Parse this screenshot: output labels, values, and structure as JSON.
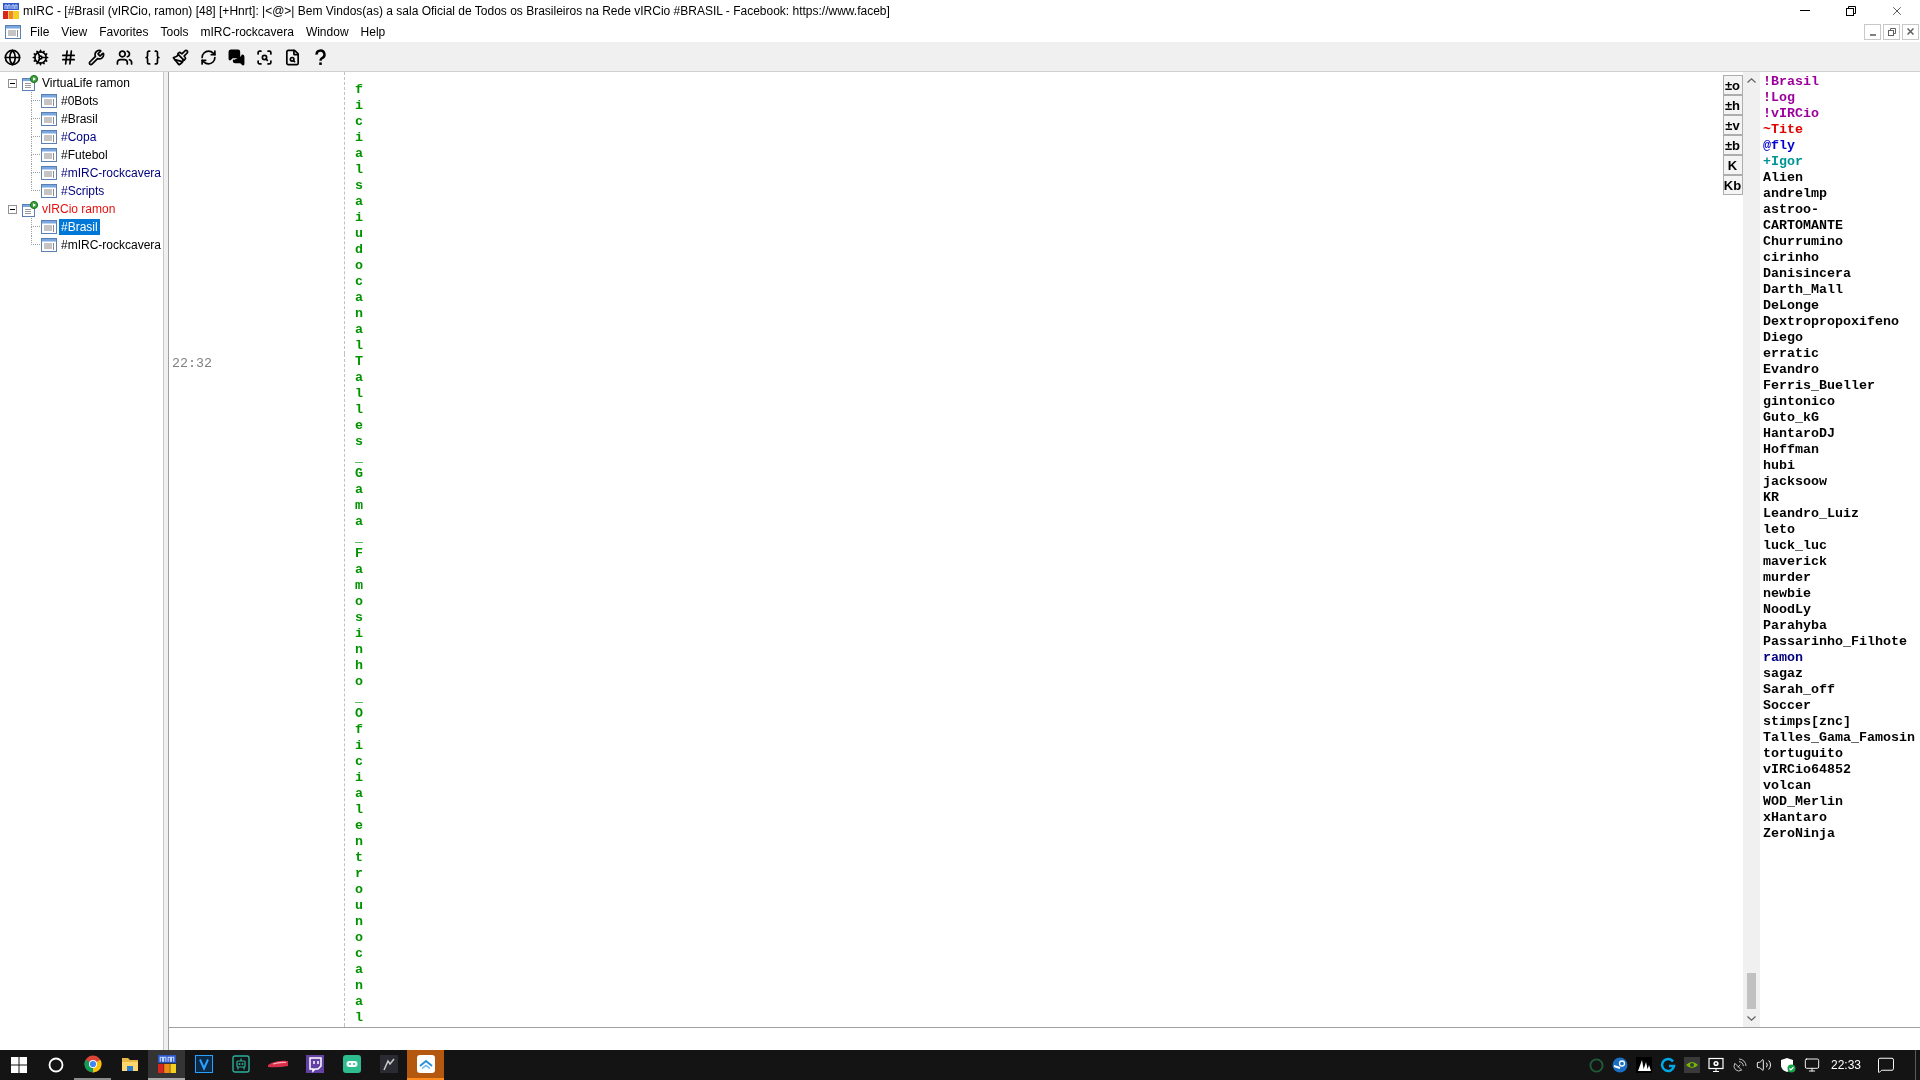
{
  "window": {
    "title": "mIRC - [#Brasil (vIRCio, ramon) [48] [+Hnrt]: |<@>| Bem Vindos(as) a sala Oficial de Todos os Brasileiros na Rede vIRCio #BRASIL - Facebook: https://www.faceb]"
  },
  "menu": [
    "File",
    "View",
    "Favorites",
    "Tools",
    "mIRC-rockcavera",
    "Window",
    "Help"
  ],
  "treebar": {
    "items": [
      {
        "label": "VirtuaLife ramon",
        "color": "#000000",
        "selected": false,
        "expanded": true,
        "children": [
          {
            "label": "#0Bots",
            "color": "#000000",
            "selected": false
          },
          {
            "label": "#Brasil",
            "color": "#000000",
            "selected": false
          },
          {
            "label": "#Copa",
            "color": "#00007f",
            "selected": false
          },
          {
            "label": "#Futebol",
            "color": "#000000",
            "selected": false
          },
          {
            "label": "#mIRC-rockcavera",
            "color": "#00007f",
            "selected": false
          },
          {
            "label": "#Scripts",
            "color": "#00007f",
            "selected": false
          }
        ]
      },
      {
        "label": "vIRCio ramon",
        "color": "#e81010",
        "selected": false,
        "expanded": true,
        "children": [
          {
            "label": "#Brasil",
            "selected": true
          },
          {
            "label": "#mIRC-rockcavera",
            "color": "#000000",
            "selected": false
          }
        ]
      }
    ]
  },
  "chat": {
    "lines": [
      {
        "text": "ficial saiu do canal"
      },
      {
        "time": "22:32",
        "text": "Talles_Gama_Famosinho_Oficial entrou no canal"
      }
    ]
  },
  "nick_buttons": [
    "±o",
    "±h",
    "±v",
    "±b",
    "K",
    "Kb"
  ],
  "nicklist": [
    {
      "nick": "!Brasil",
      "color": "#9c009c"
    },
    {
      "nick": "!Log",
      "color": "#9c009c"
    },
    {
      "nick": "!vIRCio",
      "color": "#9c009c"
    },
    {
      "nick": "~Tite",
      "color": "#e00000"
    },
    {
      "nick": "@fly",
      "color": "#0000d0"
    },
    {
      "nick": "+Igor",
      "color": "#009393"
    },
    {
      "nick": "Alien",
      "color": "#000000"
    },
    {
      "nick": "andrelmp",
      "color": "#000000"
    },
    {
      "nick": "astroo-",
      "color": "#000000"
    },
    {
      "nick": "CARTOMANTE",
      "color": "#000000"
    },
    {
      "nick": "Churrumino",
      "color": "#000000"
    },
    {
      "nick": "cirinho",
      "color": "#000000"
    },
    {
      "nick": "Danisincera",
      "color": "#000000"
    },
    {
      "nick": "Darth_Mall",
      "color": "#000000"
    },
    {
      "nick": "DeLonge",
      "color": "#000000"
    },
    {
      "nick": "Dextropropoxifeno",
      "color": "#000000"
    },
    {
      "nick": "Diego",
      "color": "#000000"
    },
    {
      "nick": "erratic",
      "color": "#000000"
    },
    {
      "nick": "Evandro",
      "color": "#000000"
    },
    {
      "nick": "Ferris_Bueller",
      "color": "#000000"
    },
    {
      "nick": "gintonico",
      "color": "#000000"
    },
    {
      "nick": "Guto_kG",
      "color": "#000000"
    },
    {
      "nick": "HantaroDJ",
      "color": "#000000"
    },
    {
      "nick": "Hoffman",
      "color": "#000000"
    },
    {
      "nick": "hubi",
      "color": "#000000"
    },
    {
      "nick": "jacksoow",
      "color": "#000000"
    },
    {
      "nick": "KR",
      "color": "#000000"
    },
    {
      "nick": "Leandro_Luiz",
      "color": "#000000"
    },
    {
      "nick": "leto",
      "color": "#000000"
    },
    {
      "nick": "luck_luc",
      "color": "#000000"
    },
    {
      "nick": "maverick",
      "color": "#000000"
    },
    {
      "nick": "murder",
      "color": "#000000"
    },
    {
      "nick": "newbie",
      "color": "#000000"
    },
    {
      "nick": "NoodLy",
      "color": "#000000"
    },
    {
      "nick": "Parahyba",
      "color": "#000000"
    },
    {
      "nick": "Passarinho_Filhote",
      "color": "#000000"
    },
    {
      "nick": "ramon",
      "color": "#00007f"
    },
    {
      "nick": "sagaz",
      "color": "#000000"
    },
    {
      "nick": "Sarah_off",
      "color": "#000000"
    },
    {
      "nick": "Soccer",
      "color": "#000000"
    },
    {
      "nick": "stimps[znc]",
      "color": "#000000"
    },
    {
      "nick": "Talles_Gama_Famosin",
      "color": "#000000"
    },
    {
      "nick": "tortuguito",
      "color": "#000000"
    },
    {
      "nick": "vIRCio64852",
      "color": "#000000"
    },
    {
      "nick": "volcan",
      "color": "#000000"
    },
    {
      "nick": "WOD_Merlin",
      "color": "#000000"
    },
    {
      "nick": "xHantaro",
      "color": "#000000"
    },
    {
      "nick": "ZeroNinja",
      "color": "#000000"
    }
  ],
  "taskbar": {
    "apps": [
      {
        "kind": "browser",
        "running": true,
        "active": false,
        "flashing": false
      },
      {
        "kind": "folder",
        "running": false,
        "active": false,
        "flashing": false
      },
      {
        "kind": "irc",
        "running": true,
        "active": true,
        "flashing": false
      },
      {
        "kind": "letter-v",
        "running": false,
        "active": false,
        "flashing": false
      },
      {
        "kind": "robot",
        "running": false,
        "active": false,
        "flashing": false
      },
      {
        "kind": "streak",
        "running": false,
        "active": false,
        "flashing": false
      },
      {
        "kind": "chat-tile",
        "running": false,
        "active": false,
        "flashing": false
      },
      {
        "kind": "pill-tile",
        "running": false,
        "active": false,
        "flashing": false
      },
      {
        "kind": "dark-picture",
        "running": false,
        "active": false,
        "flashing": false
      },
      {
        "kind": "chevron-tile",
        "running": true,
        "active": false,
        "flashing": true
      }
    ],
    "clock": "22:33"
  }
}
